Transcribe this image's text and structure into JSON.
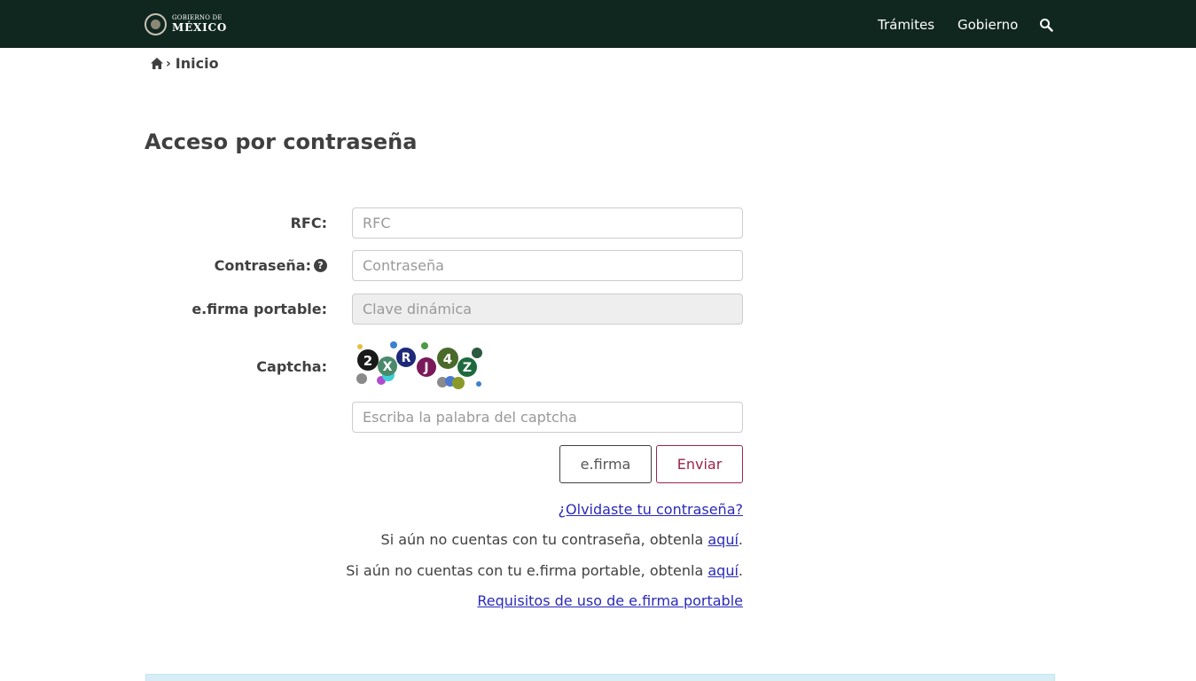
{
  "header": {
    "logo_line1": "GOBIERNO DE",
    "logo_line2": "MÉXICO",
    "nav": {
      "tramites": "Trámites",
      "gobierno": "Gobierno"
    },
    "icons": {
      "search": "search-icon",
      "logo": "seal-icon"
    }
  },
  "breadcrumb": {
    "separator": "›",
    "current": "Inicio"
  },
  "page": {
    "title": "Acceso por contraseña"
  },
  "form": {
    "rfc": {
      "label": "RFC:",
      "placeholder": "RFC"
    },
    "password": {
      "label": "Contraseña:",
      "placeholder": "Contraseña",
      "help": "?"
    },
    "efirma": {
      "label": "e.firma portable:",
      "placeholder": "Clave dinámica"
    },
    "captcha": {
      "label": "Captcha:",
      "placeholder": "Escriba la palabra del captcha",
      "text": "2XRJ4Z"
    }
  },
  "buttons": {
    "efirma": "e.firma",
    "enviar": "Enviar"
  },
  "links": {
    "forgot": "¿Olvidaste tu contraseña?",
    "pass_prefix": "Si aún no cuentas con tu contraseña, obtenla ",
    "pass_link": "aquí",
    "efirma_prefix": "Si aún no cuentas con tu e.firma portable, obtenla ",
    "efirma_link": "aquí",
    "period": ".",
    "requisitos": "Requisitos de uso de e.firma portable"
  },
  "colors": {
    "topbar": "#10271f",
    "accent": "#9d2449",
    "link": "#2a2ab8",
    "text": "#404041"
  }
}
